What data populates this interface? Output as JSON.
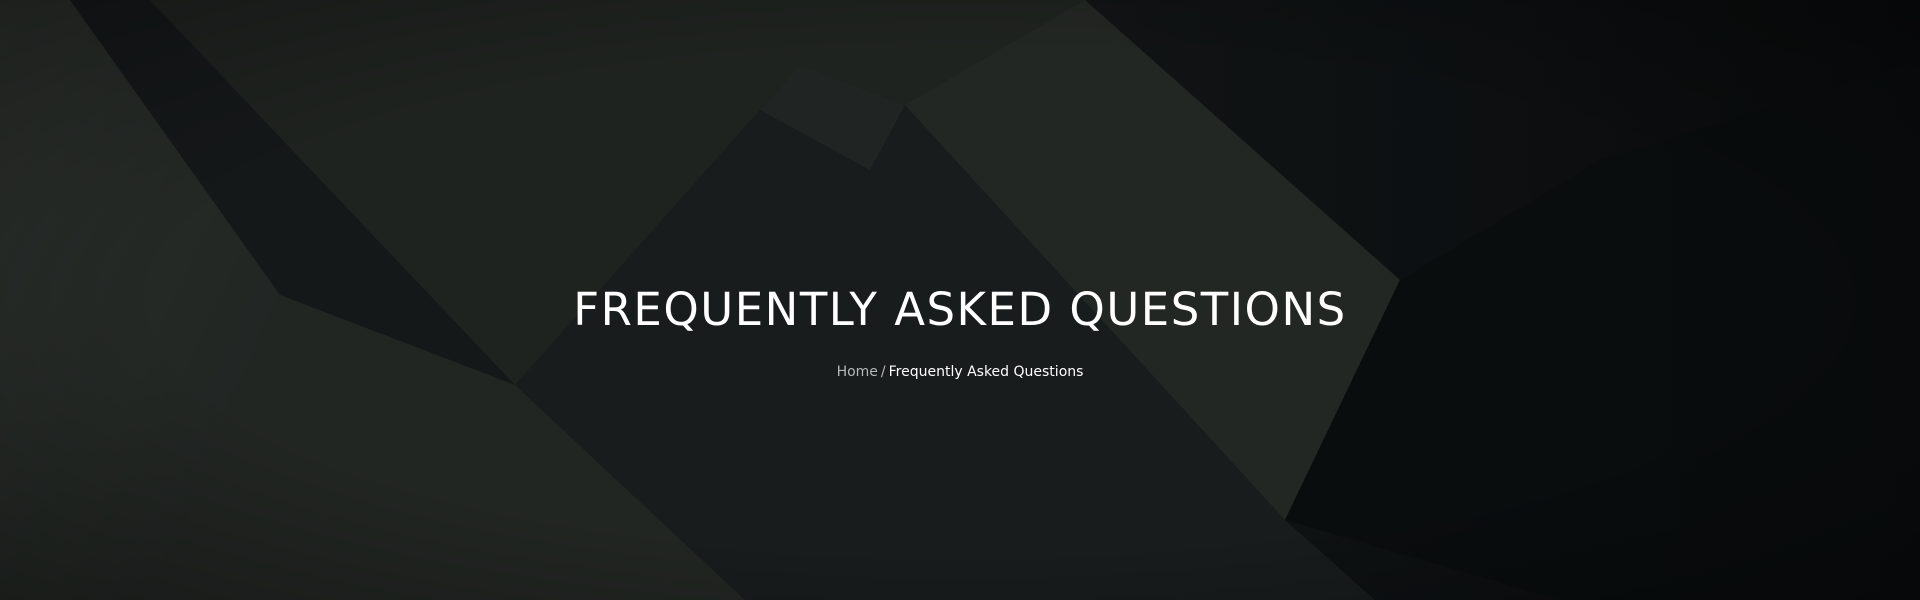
{
  "hero": {
    "title": "FREQUENTLY ASKED QUESTIONS",
    "background_icon": "dark-concrete-geometric-background"
  },
  "breadcrumb": {
    "home_label": "Home",
    "separator": "/",
    "current_label": "Frequently Asked Questions"
  },
  "colors": {
    "title_text": "#ffffff",
    "breadcrumb_link": "#b4b8b8",
    "background_dark": "#111516"
  }
}
